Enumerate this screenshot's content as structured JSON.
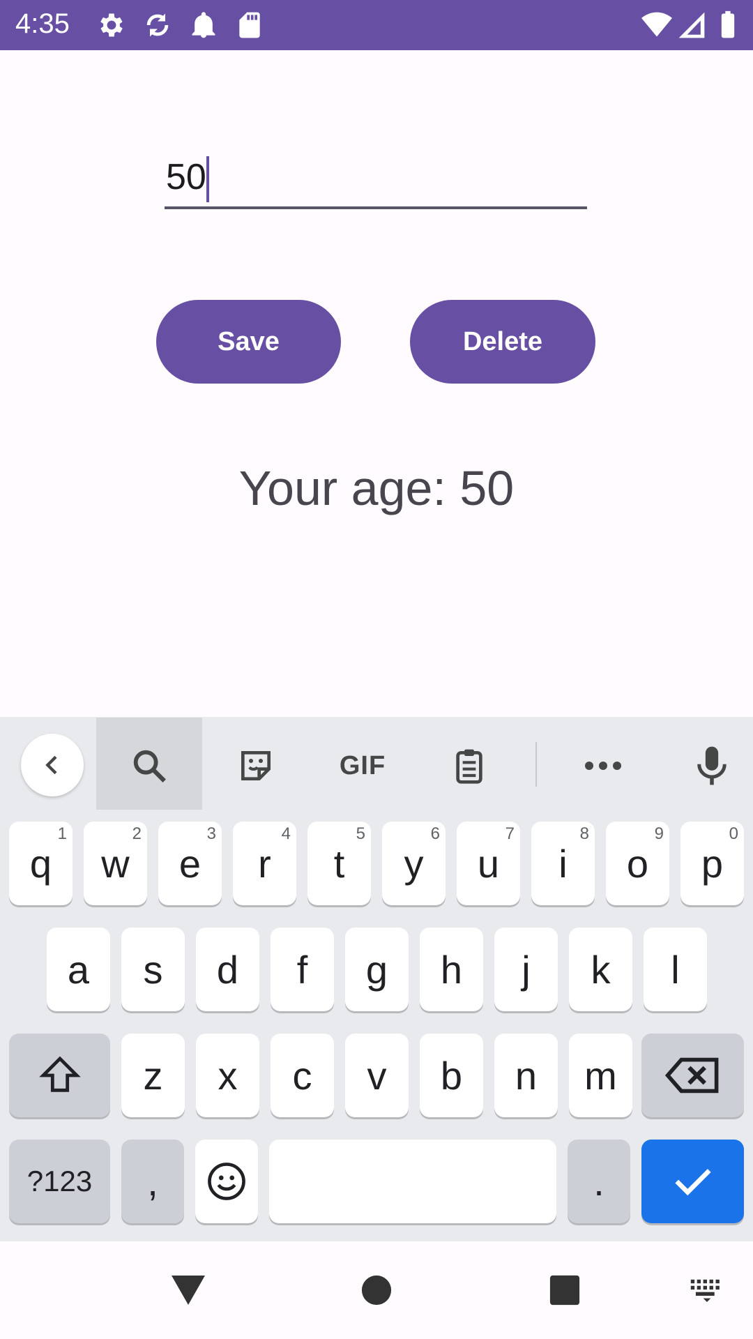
{
  "status_bar": {
    "time": "4:35",
    "icons_left": [
      "settings-icon",
      "sync-icon",
      "notification-bell-icon",
      "sd-card-icon"
    ],
    "icons_right": [
      "wifi-icon",
      "signal-icon",
      "battery-icon"
    ],
    "background": "#6750a4"
  },
  "form": {
    "age_input_value": "50",
    "save_label": "Save",
    "delete_label": "Delete",
    "result_text": "Your age: 50"
  },
  "colors": {
    "primary": "#6750a4",
    "background": "#fffbfe",
    "keyboard_bg": "#e8eaed",
    "enter_key": "#1a73e8"
  },
  "keyboard": {
    "toolbar": {
      "items": [
        "back-icon",
        "search-icon",
        "sticker-icon",
        "gif",
        "clipboard-icon",
        "more-icon",
        "mic-icon"
      ],
      "gif_label": "GIF"
    },
    "row1": [
      {
        "k": "q",
        "h": "1"
      },
      {
        "k": "w",
        "h": "2"
      },
      {
        "k": "e",
        "h": "3"
      },
      {
        "k": "r",
        "h": "4"
      },
      {
        "k": "t",
        "h": "5"
      },
      {
        "k": "y",
        "h": "6"
      },
      {
        "k": "u",
        "h": "7"
      },
      {
        "k": "i",
        "h": "8"
      },
      {
        "k": "o",
        "h": "9"
      },
      {
        "k": "p",
        "h": "0"
      }
    ],
    "row2": [
      "a",
      "s",
      "d",
      "f",
      "g",
      "h",
      "j",
      "k",
      "l"
    ],
    "row3": [
      "z",
      "x",
      "c",
      "v",
      "b",
      "n",
      "m"
    ],
    "row4": {
      "symbols_label": "?123",
      "comma_label": ",",
      "period_label": "."
    }
  },
  "nav_bar": {
    "items": [
      "back-triangle-icon",
      "home-circle-icon",
      "recents-square-icon",
      "keyboard-switch-icon"
    ]
  }
}
